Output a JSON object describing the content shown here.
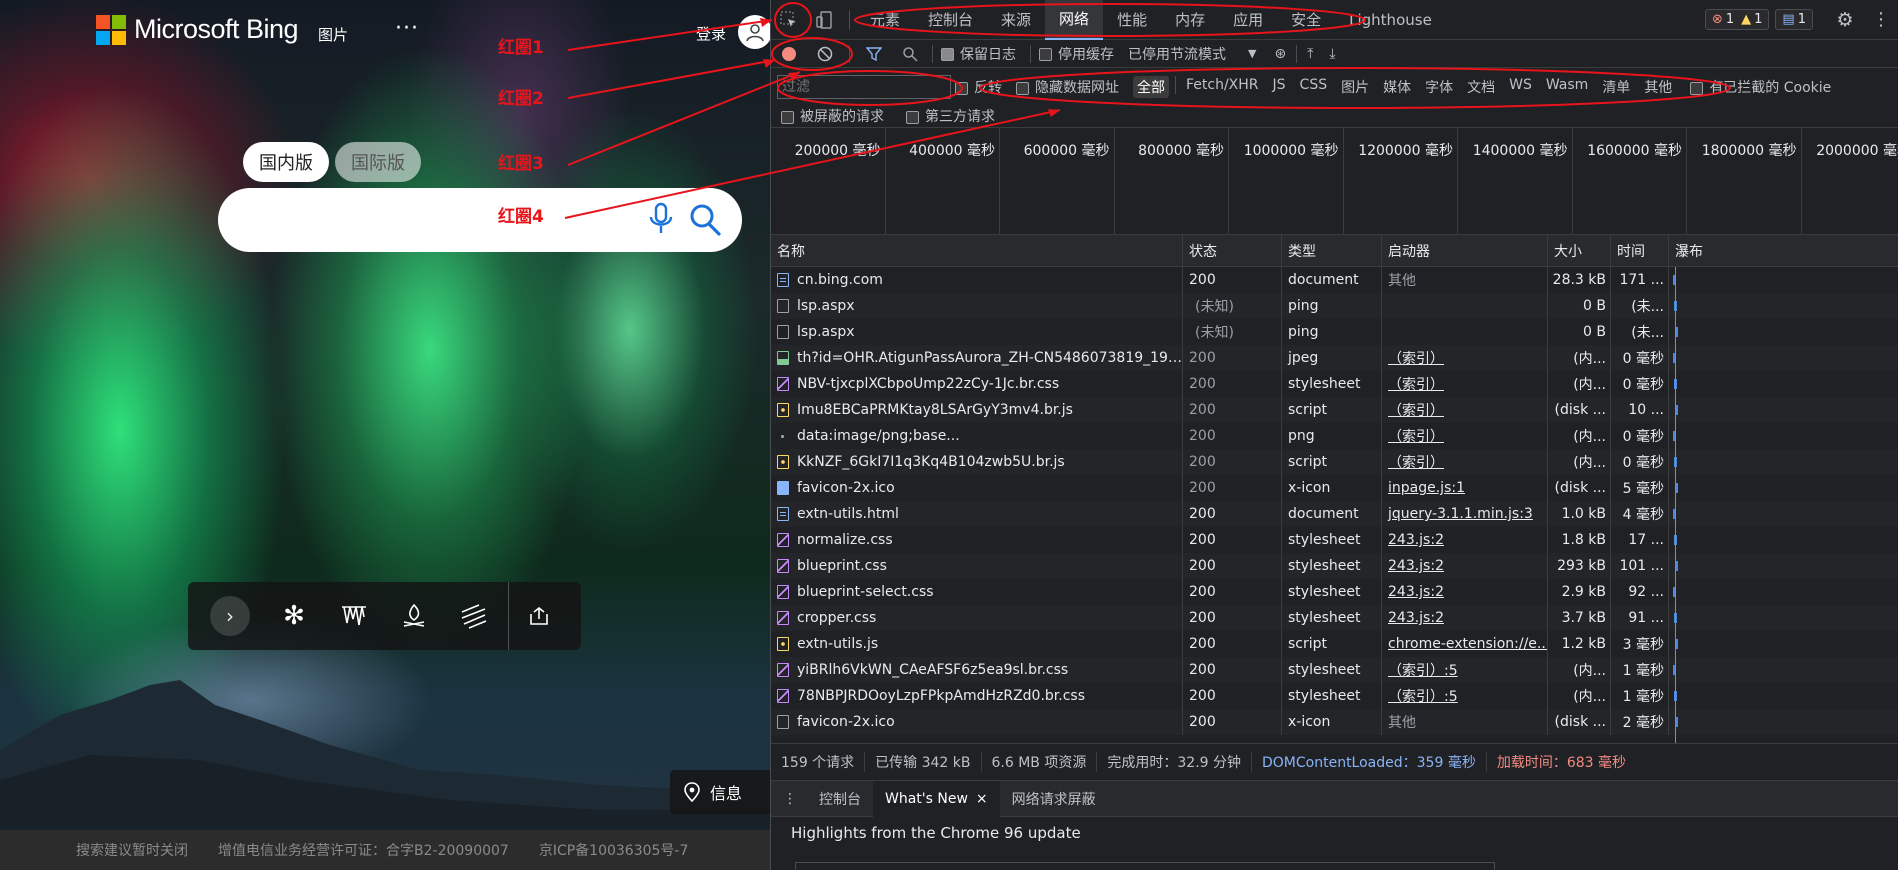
{
  "bing": {
    "logo_text": "Microsoft Bing",
    "nav_images": "图片",
    "nav_more": "···",
    "login": "登录",
    "scope_tabs": [
      {
        "label": "国内版",
        "active": true
      },
      {
        "label": "国际版",
        "active": false
      }
    ],
    "search_placeholder": "",
    "info_label": "信息",
    "footer": [
      "搜索建议暂时关闭",
      "增值电信业务经营许可证：合字B2-20090007",
      "京ICP备10036305号-7"
    ],
    "toolbar_icons": [
      "next-icon",
      "snowflake-icon",
      "icicles-icon",
      "campfire-icon",
      "wind-icon",
      "share-icon"
    ]
  },
  "annotations": {
    "circle1": "红圈1",
    "circle2": "红圈2",
    "circle3": "红圈3",
    "circle4": "红圈4",
    "color": "#e8141b"
  },
  "devtools": {
    "tabs": [
      {
        "label": "元素",
        "active": false
      },
      {
        "label": "控制台",
        "active": false
      },
      {
        "label": "来源",
        "active": false
      },
      {
        "label": "网络",
        "active": true
      },
      {
        "label": "性能",
        "active": false
      },
      {
        "label": "内存",
        "active": false
      },
      {
        "label": "应用",
        "active": false
      },
      {
        "label": "安全",
        "active": false
      },
      {
        "label": "Lighthouse",
        "active": false
      }
    ],
    "badges": {
      "errors": "1",
      "warnings": "1",
      "messages": "1"
    },
    "toolbar": {
      "preserve_log": "保留日志",
      "preserve_log_checked": true,
      "disable_cache": "停用缓存",
      "disable_cache_checked": false,
      "throttling": "已停用节流模式"
    },
    "filter": {
      "placeholder": "过滤",
      "invert": "反转",
      "hide_data_urls": "隐藏数据网址",
      "types": [
        "全部",
        "Fetch/XHR",
        "JS",
        "CSS",
        "图片",
        "媒体",
        "字体",
        "文档",
        "WS",
        "Wasm",
        "清单",
        "其他"
      ],
      "active_type": "全部",
      "blocked_cookies": "有已拦截的 Cookie",
      "blocked_requests": "被屏蔽的请求",
      "third_party": "第三方请求"
    },
    "timeline_ticks": [
      "200000 毫秒",
      "400000 毫秒",
      "600000 毫秒",
      "800000 毫秒",
      "1000000 毫秒",
      "1200000 毫秒",
      "1400000 毫秒",
      "1600000 毫秒",
      "1800000 毫秒",
      "2000000 毫秒"
    ],
    "columns": [
      "名称",
      "状态",
      "类型",
      "启动器",
      "大小",
      "时间",
      "瀑布"
    ],
    "rows": [
      {
        "icon": "doc",
        "name": "cn.bing.com",
        "status": "200",
        "type": "document",
        "initiator": "其他",
        "initiator_link": false,
        "size": "28.3 kB",
        "time": "171 ..."
      },
      {
        "icon": "ping",
        "name": "lsp.aspx",
        "status": "(未知)",
        "type": "ping",
        "initiator": "",
        "initiator_link": false,
        "size": "0 B",
        "time": "(未..."
      },
      {
        "icon": "ping",
        "name": "lsp.aspx",
        "status": "(未知)",
        "type": "ping",
        "initiator": "",
        "initiator_link": false,
        "size": "0 B",
        "time": "(未..."
      },
      {
        "icon": "img",
        "name": "th?id=OHR.AtigunPassAurora_ZH-CN5486073819_192...",
        "status": "200",
        "type": "jpeg",
        "initiator": "（索引）",
        "initiator_link": true,
        "size": "(内...",
        "time": "0 毫秒"
      },
      {
        "icon": "css",
        "name": "NBV-tjxcplXCbpoUmp22zCy-1Jc.br.css",
        "status": "200",
        "type": "stylesheet",
        "initiator": "（索引）",
        "initiator_link": true,
        "size": "(内...",
        "time": "0 毫秒"
      },
      {
        "icon": "js",
        "name": "Imu8EBCaPRMKtay8LSArGyY3mv4.br.js",
        "status": "200",
        "type": "script",
        "initiator": "（索引）",
        "initiator_link": true,
        "size": "(disk ...",
        "time": "10 ..."
      },
      {
        "icon": "dot",
        "name": "data:image/png;base...",
        "status": "200",
        "type": "png",
        "initiator": "（索引）",
        "initiator_link": true,
        "size": "(内...",
        "time": "0 毫秒"
      },
      {
        "icon": "js",
        "name": "KkNZF_6GkI7I1q3Kq4B104zwb5U.br.js",
        "status": "200",
        "type": "script",
        "initiator": "（索引）",
        "initiator_link": true,
        "size": "(内...",
        "time": "0 毫秒"
      },
      {
        "icon": "ico",
        "name": "favicon-2x.ico",
        "status": "200",
        "type": "x-icon",
        "initiator": "inpage.js:1",
        "initiator_link": true,
        "size": "(disk ...",
        "time": "5 毫秒"
      },
      {
        "icon": "doc",
        "name": "extn-utils.html",
        "status": "200",
        "type": "document",
        "initiator": "jquery-3.1.1.min.js:3",
        "initiator_link": true,
        "size": "1.0 kB",
        "time": "4 毫秒"
      },
      {
        "icon": "css",
        "name": "normalize.css",
        "status": "200",
        "type": "stylesheet",
        "initiator": "243.js:2",
        "initiator_link": true,
        "size": "1.8 kB",
        "time": "17 ..."
      },
      {
        "icon": "css",
        "name": "blueprint.css",
        "status": "200",
        "type": "stylesheet",
        "initiator": "243.js:2",
        "initiator_link": true,
        "size": "293 kB",
        "time": "101 ..."
      },
      {
        "icon": "css",
        "name": "blueprint-select.css",
        "status": "200",
        "type": "stylesheet",
        "initiator": "243.js:2",
        "initiator_link": true,
        "size": "2.9 kB",
        "time": "92 ..."
      },
      {
        "icon": "css",
        "name": "cropper.css",
        "status": "200",
        "type": "stylesheet",
        "initiator": "243.js:2",
        "initiator_link": true,
        "size": "3.7 kB",
        "time": "91 ..."
      },
      {
        "icon": "js",
        "name": "extn-utils.js",
        "status": "200",
        "type": "script",
        "initiator": "chrome-extension://e...",
        "initiator_link": true,
        "size": "1.2 kB",
        "time": "3 毫秒"
      },
      {
        "icon": "css",
        "name": "yiBRlh6VkWN_CAeAFSF6z5ea9sl.br.css",
        "status": "200",
        "type": "stylesheet",
        "initiator": "（索引）:5",
        "initiator_link": true,
        "size": "(内...",
        "time": "1 毫秒"
      },
      {
        "icon": "css",
        "name": "78NBPJRDOoyLzpFPkpAmdHzRZd0.br.css",
        "status": "200",
        "type": "stylesheet",
        "initiator": "（索引）:5",
        "initiator_link": true,
        "size": "(内...",
        "time": "1 毫秒"
      },
      {
        "icon": "ping",
        "name": "favicon-2x.ico",
        "status": "200",
        "type": "x-icon",
        "initiator": "其他",
        "initiator_link": false,
        "size": "(disk ...",
        "time": "2 毫秒"
      }
    ],
    "summary": {
      "requests": "159 个请求",
      "transferred": "已传输 342 kB",
      "resources": "6.6 MB 项资源",
      "finish": "完成用时：32.9 分钟",
      "dcl": "DOMContentLoaded：359 毫秒",
      "load": "加载时间：683 毫秒"
    },
    "drawer": {
      "tabs": [
        "控制台",
        "What's New",
        "网络请求屏蔽"
      ],
      "active_tab": "What's New",
      "highlight": "Highlights from the Chrome 96 update"
    }
  }
}
